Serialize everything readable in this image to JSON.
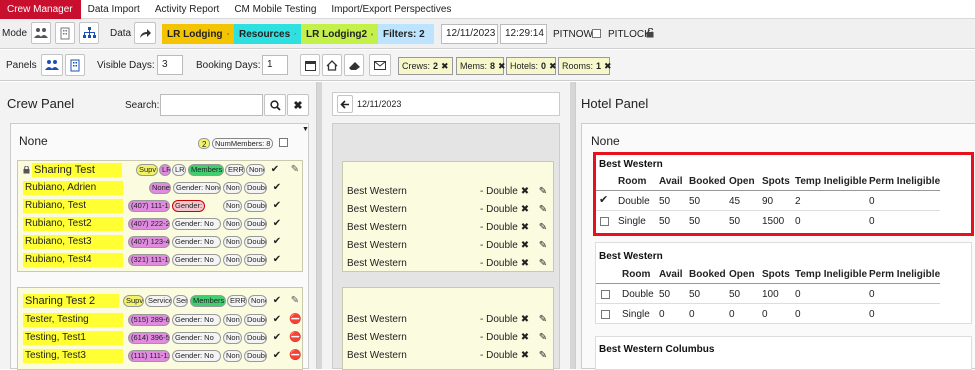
{
  "menu": {
    "tabs": [
      {
        "label": "Crew Manager",
        "active": true
      },
      {
        "label": "Data Import"
      },
      {
        "label": "Activity Report"
      },
      {
        "label": "CM Mobile Testing"
      },
      {
        "label": "Import/Export Perspectives"
      }
    ]
  },
  "toolbar": {
    "mode_label": "Mode",
    "data_label": "Data",
    "chips": [
      {
        "label": "LR Lodging",
        "color": "#f5c400"
      },
      {
        "label": "Resources",
        "color": "#2fe0e0"
      },
      {
        "label": "LR Lodging2",
        "color": "#c4f04a"
      },
      {
        "label": "Filters: 2",
        "color": "#bde4ff"
      }
    ],
    "date": "12/11/2023",
    "time": "12:29:14",
    "pitnow_label": "PITNOW:",
    "pitlock_label": "PITLOCK:",
    "panels_label": "Panels",
    "visible_days_label": "Visible Days:",
    "visible_days_value": "3",
    "booking_days_label": "Booking Days:",
    "booking_days_value": "1",
    "filters": [
      {
        "key": "Crews:",
        "val": "2"
      },
      {
        "key": "Mems:",
        "val": "8"
      },
      {
        "key": "Hotels:",
        "val": "0"
      },
      {
        "key": "Rooms:",
        "val": "1"
      }
    ]
  },
  "crew_panel": {
    "title": "Crew Panel",
    "search_label": "Search:",
    "search_value": "",
    "group_title": "None",
    "group_count": "2",
    "group_members": "NumMembers: 8",
    "crews": [
      {
        "name": "Sharing Test",
        "tags": [
          "Supv",
          "LR",
          "LR",
          "Members",
          "ERR",
          "None"
        ],
        "members": [
          {
            "name": "Rubiano, Adrien",
            "tags": [
              "None",
              "Gender: None",
              "Non",
              "Double"
            ]
          },
          {
            "name": "Rubiano, Test",
            "tags": [
              "(407) 111-1111",
              "Gender:",
              "Non",
              "Double"
            ]
          },
          {
            "name": "Rubiano, Test2",
            "tags": [
              "(407) 222-2222",
              "Gender: No",
              "Non",
              "Double"
            ]
          },
          {
            "name": "Rubiano, Test3",
            "tags": [
              "(407) 123-4567",
              "Gender: No",
              "Non",
              "Double"
            ]
          },
          {
            "name": "Rubiano, Test4",
            "tags": [
              "(321) 111-1111",
              "Gender: No",
              "Non",
              "Double"
            ]
          }
        ]
      },
      {
        "name": "Sharing Test 2",
        "tags": [
          "Supv",
          "Service",
          "Ser",
          "Members",
          "ERR",
          "None"
        ],
        "members": [
          {
            "name": "Tester, Testing",
            "tags": [
              "(515) 289-6767",
              "Gender: No",
              "Non",
              "Double"
            ]
          },
          {
            "name": "Testing, Test1",
            "tags": [
              "(614) 396-5612",
              "Gender: No",
              "Non",
              "Double"
            ]
          },
          {
            "name": "Testing, Test3",
            "tags": [
              "(111) 111-1111",
              "Gender: No",
              "Non",
              "Double"
            ]
          }
        ]
      }
    ]
  },
  "mid_panel": {
    "date": "12/11/2023",
    "card1_rows": [
      {
        "hotel": "Best Western",
        "type": "- Double"
      },
      {
        "hotel": "Best Western",
        "type": "- Double"
      },
      {
        "hotel": "Best Western",
        "type": "- Double"
      },
      {
        "hotel": "Best Western",
        "type": "- Double"
      },
      {
        "hotel": "Best Western",
        "type": "- Double"
      }
    ],
    "card2_rows": [
      {
        "hotel": "Best Western",
        "type": "- Double"
      },
      {
        "hotel": "Best Western",
        "type": "- Double"
      },
      {
        "hotel": "Best Western",
        "type": "- Double"
      }
    ]
  },
  "hotel_panel": {
    "title": "Hotel Panel",
    "group_title": "None",
    "columns": [
      "Room",
      "Avail",
      "Booked",
      "Open",
      "Spots",
      "Temp Ineligible",
      "Perm Ineligible"
    ],
    "hotels": [
      {
        "name": "Best Western",
        "highlight": true,
        "rooms": [
          {
            "checked": true,
            "cells": [
              "Double",
              "50",
              "50",
              "45",
              "90",
              "2",
              "0"
            ]
          },
          {
            "checked": false,
            "cells": [
              "Single",
              "50",
              "50",
              "50",
              "1500",
              "0",
              "0"
            ]
          }
        ]
      },
      {
        "name": "Best Western",
        "highlight": false,
        "rooms": [
          {
            "checked": false,
            "cells": [
              "Double",
              "50",
              "50",
              "50",
              "100",
              "0",
              "0"
            ]
          },
          {
            "checked": false,
            "cells": [
              "Single",
              "0",
              "0",
              "0",
              "0",
              "0",
              "0"
            ]
          }
        ]
      },
      {
        "name": "Best Western Columbus",
        "highlight": false,
        "rooms": []
      }
    ],
    "highlight_color": "#e8101c"
  }
}
